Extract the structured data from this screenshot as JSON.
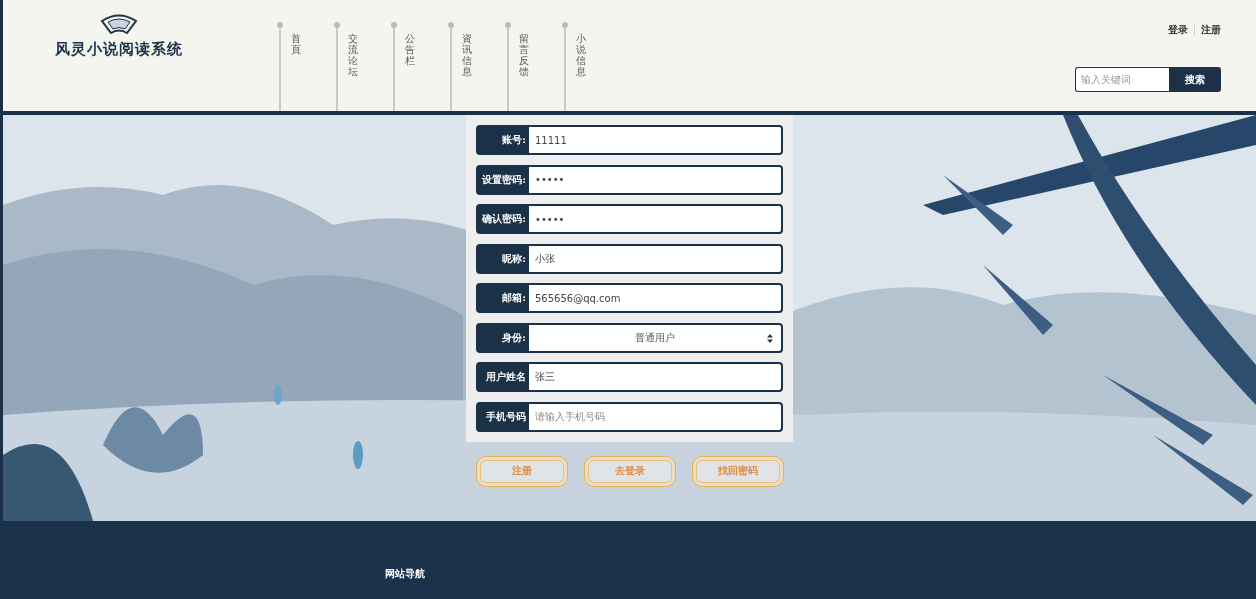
{
  "header": {
    "site_title": "风灵小说阅读系统",
    "nav": [
      {
        "label": "首頁"
      },
      {
        "label": "交流论坛"
      },
      {
        "label": "公告栏"
      },
      {
        "label": "資讯信息"
      },
      {
        "label": "留言反馈"
      },
      {
        "label": "小说信息"
      }
    ],
    "auth_links": [
      "登录",
      "注册"
    ],
    "search": {
      "placeholder": "输入关键词",
      "button": "搜索"
    }
  },
  "form": {
    "fields": [
      {
        "kind": "text",
        "label": "账号:",
        "value": "11111"
      },
      {
        "kind": "text",
        "label": "设置密码:",
        "value": "•••••"
      },
      {
        "kind": "text",
        "label": "确认密码:",
        "value": "•••••"
      },
      {
        "kind": "text",
        "label": "昵称:",
        "value": "小张"
      },
      {
        "kind": "text",
        "label": "邮箱:",
        "value": "565656@qq.com"
      },
      {
        "kind": "select",
        "label": "身份:",
        "value": "普通用户"
      },
      {
        "kind": "text",
        "label": "用户姓名",
        "value": "张三"
      },
      {
        "kind": "text",
        "label": "手机号码",
        "placeholder": "请输入手机号码"
      }
    ],
    "buttons": [
      "注册",
      "去登录",
      "找回密码"
    ]
  },
  "footer": {
    "heading": "网站导航"
  }
}
